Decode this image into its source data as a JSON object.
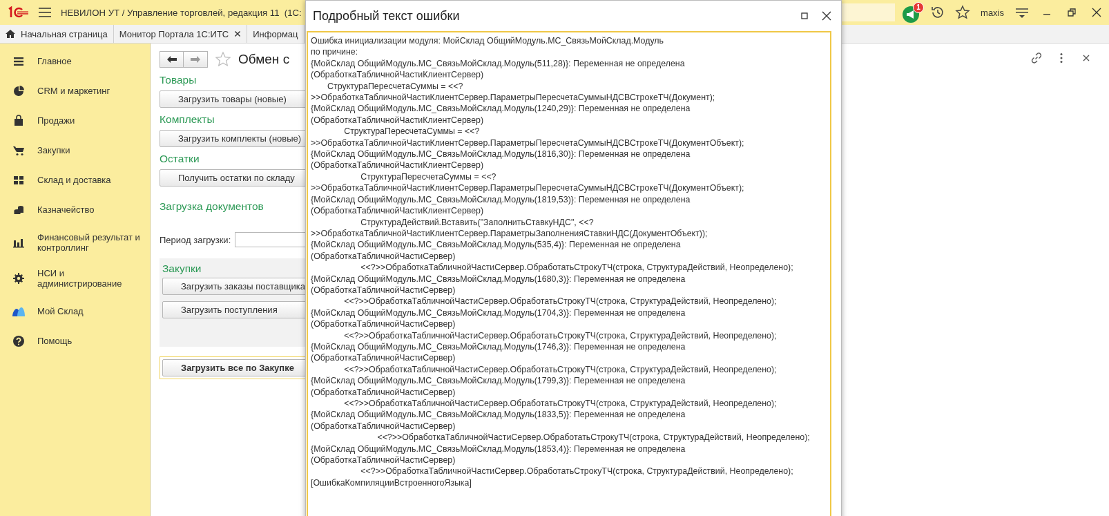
{
  "app_bar": {
    "title": "НЕВИЛОН УТ / Управление торговлей, редакция 11  (1С:",
    "notification_count": "1",
    "user": "maxis"
  },
  "tabs": [
    {
      "label": "Начальная страница",
      "kind": "home"
    },
    {
      "label": "Монитор Портала 1С:ИТС",
      "kind": "closable"
    },
    {
      "label": "Информац",
      "kind": "plain"
    }
  ],
  "sidebar": {
    "items": [
      {
        "label": "Главное"
      },
      {
        "label": "CRM и маркетинг"
      },
      {
        "label": "Продажи"
      },
      {
        "label": "Закупки"
      },
      {
        "label": "Склад и доставка"
      },
      {
        "label": "Казначейство"
      },
      {
        "label": "Финансовый результат и контроллинг"
      },
      {
        "label": "НСИ и администрирование"
      },
      {
        "label": "Мой Склад"
      },
      {
        "label": "Помощь"
      }
    ]
  },
  "form": {
    "title": "Обмен с",
    "blocks": [
      {
        "kind": "heading",
        "text": "Товары"
      },
      {
        "kind": "button",
        "label": "Загрузить товары (новые)"
      },
      {
        "kind": "heading",
        "text": "Комплекты"
      },
      {
        "kind": "button",
        "label": "Загрузить комплекты (новые)"
      },
      {
        "kind": "heading",
        "text": "Остатки"
      },
      {
        "kind": "button",
        "label": "Получить остатки по складу"
      },
      {
        "kind": "heading",
        "text": "Загрузка документов"
      },
      {
        "kind": "field",
        "label": "Период загрузки:"
      },
      {
        "kind": "group",
        "title": "Закупки",
        "buttons": [
          "Загрузить заказы поставщика",
          "Загрузить поступления"
        ]
      },
      {
        "kind": "default_button",
        "label": "Загрузить все по Закупке"
      }
    ]
  },
  "dialog": {
    "title": "Подробный текст ошибки",
    "lines": [
      "Ошибка инициализации модуля: МойСклад ОбщийМодуль.МС_СвязьМойСклад.Модуль",
      "по причине:",
      "{МойСклад ОбщийМодуль.МС_СвязьМойСклад.Модуль(511,28)}: Переменная не определена",
      "(ОбработкаТабличнойЧастиКлиентСервер)",
      "       СтруктураПересчетаСуммы = <<?",
      ">>ОбработкаТабличнойЧастиКлиентСервер.ПараметрыПересчетаСуммыНДСВСтрокеТЧ(Документ);",
      "{МойСклад ОбщийМодуль.МС_СвязьМойСклад.Модуль(1240,29)}: Переменная не определена",
      "(ОбработкаТабличнойЧастиКлиентСервер)",
      "              СтруктураПересчетаСуммы = <<?",
      ">>ОбработкаТабличнойЧастиКлиентСервер.ПараметрыПересчетаСуммыНДСВСтрокеТЧ(ДокументОбъект);",
      "{МойСклад ОбщийМодуль.МС_СвязьМойСклад.Модуль(1816,30)}: Переменная не определена",
      "(ОбработкаТабличнойЧастиКлиентСервер)",
      "                     СтруктураПересчетаСуммы = <<?",
      ">>ОбработкаТабличнойЧастиКлиентСервер.ПараметрыПересчетаСуммыНДСВСтрокеТЧ(ДокументОбъект);",
      "{МойСклад ОбщийМодуль.МС_СвязьМойСклад.Модуль(1819,53)}: Переменная не определена",
      "(ОбработкаТабличнойЧастиКлиентСервер)",
      "                     СтруктураДействий.Вставить(\"ЗаполнитьСтавкуНДС\", <<?",
      ">>ОбработкаТабличнойЧастиКлиентСервер.ПараметрыЗаполненияСтавкиНДС(ДокументОбъект));",
      "{МойСклад ОбщийМодуль.МС_СвязьМойСклад.Модуль(535,4)}: Переменная не определена",
      "(ОбработкаТабличнойЧастиСервер)",
      "                     <<?>>ОбработкаТабличнойЧастиСервер.ОбработатьСтрокуТЧ(строка, СтруктураДействий, Неопределено);",
      "{МойСклад ОбщийМодуль.МС_СвязьМойСклад.Модуль(1680,3)}: Переменная не определена",
      "(ОбработкаТабличнойЧастиСервер)",
      "              <<?>>ОбработкаТабличнойЧастиСервер.ОбработатьСтрокуТЧ(строка, СтруктураДействий, Неопределено);",
      "{МойСклад ОбщийМодуль.МС_СвязьМойСклад.Модуль(1704,3)}: Переменная не определена",
      "(ОбработкаТабличнойЧастиСервер)",
      "              <<?>>ОбработкаТабличнойЧастиСервер.ОбработатьСтрокуТЧ(строка, СтруктураДействий, Неопределено);",
      "{МойСклад ОбщийМодуль.МС_СвязьМойСклад.Модуль(1746,3)}: Переменная не определена",
      "(ОбработкаТабличнойЧастиСервер)",
      "              <<?>>ОбработкаТабличнойЧастиСервер.ОбработатьСтрокуТЧ(строка, СтруктураДействий, Неопределено);",
      "{МойСклад ОбщийМодуль.МС_СвязьМойСклад.Модуль(1799,3)}: Переменная не определена",
      "(ОбработкаТабличнойЧастиСервер)",
      "              <<?>>ОбработкаТабличнойЧастиСервер.ОбработатьСтрокуТЧ(строка, СтруктураДействий, Неопределено);",
      "{МойСклад ОбщийМодуль.МС_СвязьМойСклад.Модуль(1833,5)}: Переменная не определена",
      "(ОбработкаТабличнойЧастиСервер)",
      "                            <<?>>ОбработкаТабличнойЧастиСервер.ОбработатьСтрокуТЧ(строка, СтруктураДействий, Неопределено);",
      "{МойСклад ОбщийМодуль.МС_СвязьМойСклад.Модуль(1853,4)}: Переменная не определена",
      "(ОбработкаТабличнойЧастиСервер)",
      "                     <<?>>ОбработкаТабличнойЧастиСервер.ОбработатьСтрокуТЧ(строка, СтруктураДействий, Неопределено);",
      "[ОшибкаКомпиляцииВстроенногоЯзыка]"
    ]
  }
}
